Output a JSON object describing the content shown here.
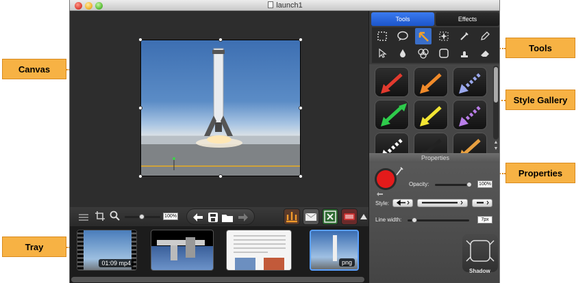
{
  "window": {
    "title": "launch1"
  },
  "callouts": {
    "canvas": "Canvas",
    "tray": "Tray",
    "tools": "Tools",
    "style_gallery": "Style Gallery",
    "properties": "Properties"
  },
  "panel": {
    "tabs": [
      {
        "label": "Tools",
        "active": true
      },
      {
        "label": "Effects",
        "active": false
      }
    ],
    "tools": [
      "selection-rect-icon",
      "speech-bubble-icon",
      "arrow-tool-icon",
      "starburst-icon",
      "eyedropper-icon",
      "pencil-icon",
      "pointer-icon",
      "blur-drop-icon",
      "shapes-icon",
      "crop-frame-icon",
      "stamp-icon",
      "eraser-icon"
    ],
    "style_gallery": [
      {
        "color": "#e23a2e",
        "dir": "sw"
      },
      {
        "color": "#f08a2a",
        "dir": "sw"
      },
      {
        "color": "#9aa8ec",
        "dir": "sw",
        "dashed": true
      },
      {
        "color": "#2ecb4b",
        "dir": "both"
      },
      {
        "color": "#f2e533",
        "dir": "sw"
      },
      {
        "color": "#b97ee8",
        "dir": "sw",
        "dashed": true
      },
      {
        "color": "#ffffff",
        "dir": "sw",
        "dashed": true
      },
      {
        "color": "#222222",
        "dir": "sw"
      },
      {
        "color": "#e8a040",
        "dir": "sw"
      }
    ],
    "properties": {
      "header": "Properties",
      "color": "#e41b1b",
      "opacity_label": "Opacity:",
      "opacity_value": "100%",
      "style_label": "Style:",
      "line_width_label": "Line width:",
      "line_width_value": "7px",
      "shadow_label": "Shadow"
    }
  },
  "tray_toolbar": {
    "zoom_value": "100%"
  },
  "tray": {
    "items": [
      {
        "label": "01:09 mp4",
        "selected": false
      },
      {
        "label": "",
        "selected": false
      },
      {
        "label": "",
        "selected": false
      },
      {
        "label": "png",
        "selected": true
      }
    ]
  }
}
